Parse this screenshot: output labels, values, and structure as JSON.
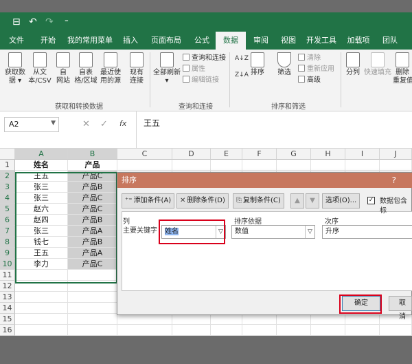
{
  "qat": {
    "save": "⊟",
    "undo": "↶",
    "redo": "↷",
    "more": "⁼"
  },
  "tabs": [
    {
      "label": "文件"
    },
    {
      "label": "开始"
    },
    {
      "label": "我的常用菜单"
    },
    {
      "label": "插入"
    },
    {
      "label": "页面布局"
    },
    {
      "label": "公式"
    },
    {
      "label": "数据"
    },
    {
      "label": "审阅"
    },
    {
      "label": "视图"
    },
    {
      "label": "开发工具"
    },
    {
      "label": "加载项"
    },
    {
      "label": "团队"
    }
  ],
  "ribbon": {
    "get_data": "获取数\n据 ▾",
    "from_text": "从文\n本/CSV",
    "from_web": "自\n网站",
    "from_table": "自表\n格/区域",
    "recent_sources": "最近使\n用的源",
    "existing_conn": "现有\n连接",
    "group_get": "获取和转换数据",
    "refresh_all": "全部刷新\n▾",
    "queries_conn": "查询和连接",
    "properties": "属性",
    "edit_links": "编辑链接",
    "group_queries": "查询和连接",
    "sort_az": "A↓Z",
    "sort_za": "Z↓A",
    "sort": "排序",
    "filter": "筛选",
    "clear": "清除",
    "reapply": "重新应用",
    "advanced": "高级",
    "group_sort": "排序和筛选",
    "split": "分列",
    "flash_fill": "快速填充",
    "remove_dup": "删除\n重复值"
  },
  "formula": {
    "namebox": "A2",
    "cancel": "✕",
    "confirm": "✓",
    "fx": "fx",
    "value": "王五"
  },
  "columns": [
    "A",
    "B",
    "C",
    "D",
    "E",
    "F",
    "G",
    "H",
    "I",
    "J"
  ],
  "rows": [
    {
      "num": "1",
      "a": "姓名",
      "b": "产品"
    },
    {
      "num": "2",
      "a": "王五",
      "b": "产品C"
    },
    {
      "num": "3",
      "a": "张三",
      "b": "产品B"
    },
    {
      "num": "4",
      "a": "张三",
      "b": "产品C"
    },
    {
      "num": "5",
      "a": "赵六",
      "b": "产品C"
    },
    {
      "num": "6",
      "a": "赵四",
      "b": "产品B"
    },
    {
      "num": "7",
      "a": "张三",
      "b": "产品A"
    },
    {
      "num": "8",
      "a": "钱七",
      "b": "产品B"
    },
    {
      "num": "9",
      "a": "王五",
      "b": "产品A"
    },
    {
      "num": "10",
      "a": "李力",
      "b": "产品C"
    },
    {
      "num": "11",
      "a": "",
      "b": ""
    },
    {
      "num": "12",
      "a": "",
      "b": ""
    },
    {
      "num": "13",
      "a": "",
      "b": ""
    },
    {
      "num": "14",
      "a": "",
      "b": ""
    },
    {
      "num": "15",
      "a": "",
      "b": ""
    },
    {
      "num": "16",
      "a": "",
      "b": ""
    },
    {
      "num": "17",
      "a": "",
      "b": ""
    }
  ],
  "dialog": {
    "title": "排序",
    "help": "?",
    "add_level": "添加条件(A)",
    "delete_level": "删除条件(D)",
    "copy_level": "复制条件(C)",
    "move_up": "▲",
    "move_down": "▼",
    "options": "选项(O)...",
    "has_headers": "数据包含标",
    "has_headers_checked": "✓",
    "col_header": "列",
    "sorton_header": "排序依据",
    "order_header": "次序",
    "primary_key": "主要关键字",
    "column_value": "姓名",
    "sorton_value": "数值",
    "order_value": "升序",
    "ok": "确定",
    "cancel": "取消"
  },
  "colors": {
    "accent": "#217346",
    "dialog_title": "#c7775e",
    "highlight_red": "#d9001b"
  }
}
